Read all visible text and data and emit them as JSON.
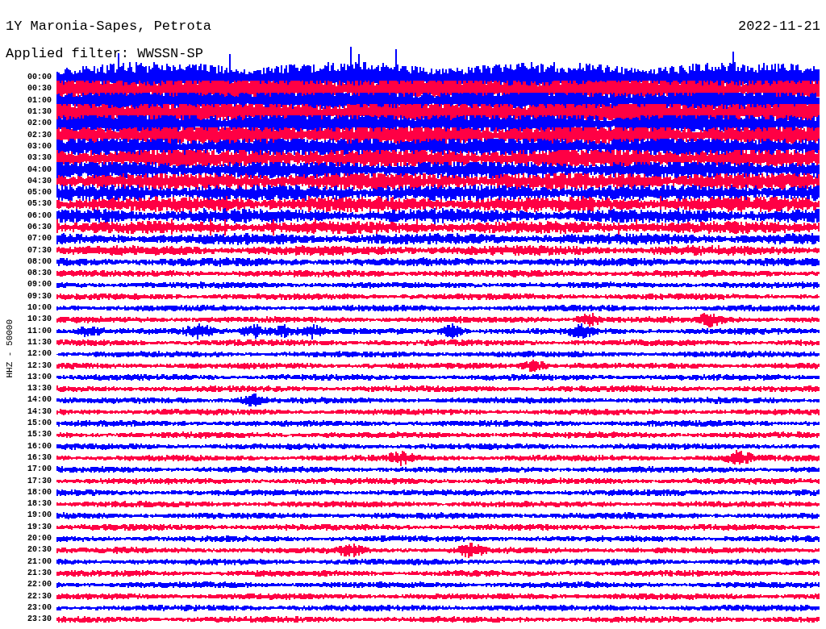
{
  "title": "1Y Maronia-Sapes, Petrota",
  "filter": "Applied filter: WWSSN-SP",
  "date": "2022-11-21",
  "axis_label": "HHZ - 50000",
  "rows": [
    {
      "time": "00:00",
      "color": "#0000ff"
    },
    {
      "time": "00:30",
      "color": "#ff0044"
    },
    {
      "time": "01:00",
      "color": "#0000ff"
    },
    {
      "time": "01:30",
      "color": "#ff0044"
    },
    {
      "time": "02:00",
      "color": "#0000ff"
    },
    {
      "time": "02:30",
      "color": "#ff0044"
    },
    {
      "time": "03:00",
      "color": "#0000ff"
    },
    {
      "time": "03:30",
      "color": "#ff0044"
    },
    {
      "time": "04:00",
      "color": "#0000ff"
    },
    {
      "time": "04:30",
      "color": "#ff0044"
    },
    {
      "time": "05:00",
      "color": "#0000ff"
    },
    {
      "time": "05:30",
      "color": "#ff0044"
    },
    {
      "time": "06:00",
      "color": "#0000ff"
    },
    {
      "time": "06:30",
      "color": "#ff0044"
    },
    {
      "time": "07:00",
      "color": "#0000ff"
    },
    {
      "time": "07:30",
      "color": "#ff0044"
    },
    {
      "time": "08:00",
      "color": "#0000ff"
    },
    {
      "time": "08:30",
      "color": "#ff0044"
    },
    {
      "time": "09:00",
      "color": "#0000ff"
    },
    {
      "time": "09:30",
      "color": "#ff0044"
    },
    {
      "time": "10:00",
      "color": "#0000ff"
    },
    {
      "time": "10:30",
      "color": "#ff0044"
    },
    {
      "time": "11:00",
      "color": "#0000ff"
    },
    {
      "time": "11:30",
      "color": "#ff0044"
    },
    {
      "time": "12:00",
      "color": "#0000ff"
    },
    {
      "time": "12:30",
      "color": "#ff0044"
    },
    {
      "time": "13:00",
      "color": "#0000ff"
    },
    {
      "time": "13:30",
      "color": "#ff0044"
    },
    {
      "time": "14:00",
      "color": "#0000ff"
    },
    {
      "time": "14:30",
      "color": "#ff0044"
    },
    {
      "time": "15:00",
      "color": "#0000ff"
    },
    {
      "time": "15:30",
      "color": "#ff0044"
    },
    {
      "time": "16:00",
      "color": "#0000ff"
    },
    {
      "time": "16:30",
      "color": "#ff0044"
    },
    {
      "time": "17:00",
      "color": "#0000ff"
    },
    {
      "time": "17:30",
      "color": "#ff0044"
    },
    {
      "time": "18:00",
      "color": "#0000ff"
    },
    {
      "time": "18:30",
      "color": "#ff0044"
    },
    {
      "time": "19:00",
      "color": "#0000ff"
    },
    {
      "time": "19:30",
      "color": "#ff0044"
    },
    {
      "time": "20:00",
      "color": "#0000ff"
    },
    {
      "time": "20:30",
      "color": "#ff0044"
    },
    {
      "time": "21:00",
      "color": "#0000ff"
    },
    {
      "time": "21:30",
      "color": "#ff0044"
    },
    {
      "time": "22:00",
      "color": "#0000ff"
    },
    {
      "time": "22:30",
      "color": "#ff0044"
    },
    {
      "time": "23:00",
      "color": "#0000ff"
    },
    {
      "time": "23:30",
      "color": "#ff0044"
    }
  ]
}
